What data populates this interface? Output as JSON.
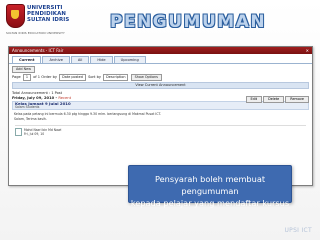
{
  "logo": {
    "university_name_lines": [
      "UNIVERSITI",
      "PENDIDIKAN",
      "SULTAN IDRIS"
    ],
    "motto": "SULTAN IDRIS EDUCATION UNIVERSITY"
  },
  "slide_title": "PENGUMUMAN",
  "window": {
    "title": "Announcements - ICT Fair",
    "close_symbol": "✕"
  },
  "tabs": [
    {
      "label": "Current"
    },
    {
      "label": "Archive"
    },
    {
      "label": "All"
    },
    {
      "label": "Hide"
    },
    {
      "label": "Upcoming"
    }
  ],
  "toolbar": {
    "add_new_label": "Add New"
  },
  "filter": {
    "page_label": "Page",
    "page_value": "1",
    "of_text": "of 1",
    "order_by_label": "Order by",
    "order_by_value": "Date posted",
    "sort_label": "Sort by",
    "sort_value": "Description",
    "show_options_label": "Show Options"
  },
  "section_title": "View Current Announcement",
  "total_announcement": "Total Announcement : 1 Post",
  "announcement": {
    "date": "Friday, July 09, 2010",
    "recent_label": "Recent",
    "edit_label": "Edit",
    "delete_label": "Delete",
    "remove_label": "Remove",
    "title": "Kelas Jumaat 9 Julai 2010",
    "from": "Salam Students",
    "body_line1": "Kelas pada petang ini bermula 6.30 ptg hingga 9.30 mlm. berlangsung di Makmal Pusat ICT.",
    "body_line2": "Salam, Terima kasih.",
    "attachment_lines": [
      "Mohd Nazri bin Md Nawi",
      "Fri, Jul 09, 10"
    ]
  },
  "callout_lines": [
    "Pensyarah boleh membuat pengumuman",
    "kepada pelajar yang mendaftar kursus"
  ],
  "footer_text": "UPSI ICT",
  "colors": {
    "title_fill": "#bcd2ec",
    "title_outline": "#2c5f9e",
    "callout_bg": "#3e6ab0",
    "window_title_bg": "#8b1515"
  }
}
